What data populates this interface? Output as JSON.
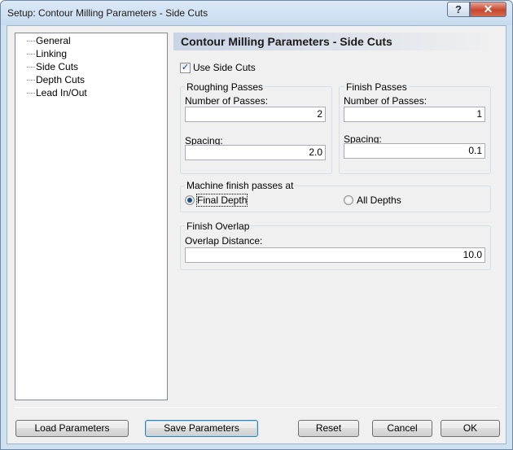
{
  "window": {
    "title": "Setup: Contour Milling Parameters - Side Cuts",
    "help_glyph": "?",
    "close_glyph": "✕"
  },
  "tree": {
    "items": [
      "General",
      "Linking",
      "Side Cuts",
      "Depth Cuts",
      "Lead In/Out"
    ]
  },
  "panel": {
    "title": "Contour Milling Parameters - Side Cuts",
    "use_side_cuts": {
      "label": "Use Side Cuts",
      "checked": true,
      "glyph": "✓"
    },
    "roughing": {
      "title": "Roughing Passes",
      "passes_label": "Number of Passes:",
      "passes_value": "2",
      "spacing_label": "Spacing:",
      "spacing_value": "2.0"
    },
    "finish": {
      "title": "Finish Passes",
      "passes_label": "Number of Passes:",
      "passes_value": "1",
      "spacing_label": "Spacing:",
      "spacing_value": "0.1"
    },
    "machine_finish": {
      "title": "Machine finish passes at",
      "options": [
        {
          "label": "Final Depth",
          "selected": true
        },
        {
          "label": "All Depths",
          "selected": false
        }
      ]
    },
    "overlap": {
      "title": "Finish Overlap",
      "distance_label": "Overlap Distance:",
      "distance_value": "10.0"
    }
  },
  "buttons": {
    "load": "Load Parameters",
    "save": "Save Parameters",
    "reset": "Reset",
    "cancel": "Cancel",
    "ok": "OK"
  }
}
